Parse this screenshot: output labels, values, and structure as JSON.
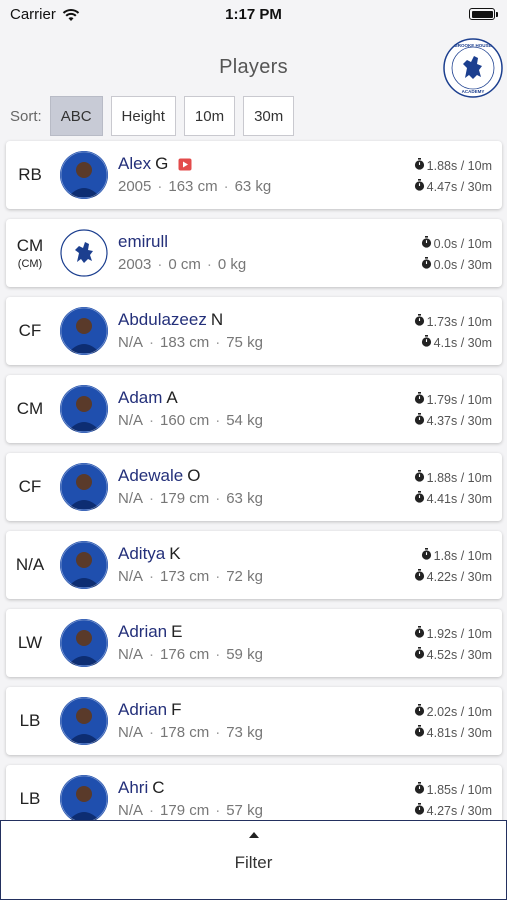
{
  "status_bar": {
    "carrier": "Carrier",
    "time": "1:17 PM"
  },
  "header": {
    "title": "Players",
    "logo_text": "BROOKE HOUSE COLLEGE FOOTBALL ACADEMY"
  },
  "sort": {
    "label": "Sort:",
    "options": [
      "ABC",
      "Height",
      "10m",
      "30m"
    ],
    "active": "ABC"
  },
  "players": [
    {
      "position": "RB",
      "position_sub": "",
      "first_name": "Alex",
      "last_name": "G",
      "year": "2005",
      "height": "163 cm",
      "weight": "63 kg",
      "time_10m": "1.88s / 10m",
      "time_30m": "4.47s / 30m",
      "avatar": "photo",
      "has_video": true
    },
    {
      "position": "CM",
      "position_sub": "(CM)",
      "first_name": "emirull",
      "last_name": "",
      "year": "2003",
      "height": "0 cm",
      "weight": "0 kg",
      "time_10m": "0.0s / 10m",
      "time_30m": "0.0s / 30m",
      "avatar": "crest",
      "has_video": false
    },
    {
      "position": "CF",
      "position_sub": "",
      "first_name": "Abdulazeez",
      "last_name": "N",
      "year": "N/A",
      "height": "183 cm",
      "weight": "75 kg",
      "time_10m": "1.73s / 10m",
      "time_30m": "4.1s / 30m",
      "avatar": "photo",
      "has_video": false
    },
    {
      "position": "CM",
      "position_sub": "",
      "first_name": "Adam",
      "last_name": "A",
      "year": "N/A",
      "height": "160 cm",
      "weight": "54 kg",
      "time_10m": "1.79s / 10m",
      "time_30m": "4.37s / 30m",
      "avatar": "photo",
      "has_video": false
    },
    {
      "position": "CF",
      "position_sub": "",
      "first_name": "Adewale",
      "last_name": "O",
      "year": "N/A",
      "height": "179 cm",
      "weight": "63 kg",
      "time_10m": "1.88s / 10m",
      "time_30m": "4.41s / 30m",
      "avatar": "photo",
      "has_video": false
    },
    {
      "position": "N/A",
      "position_sub": "",
      "first_name": "Aditya",
      "last_name": "K",
      "year": "N/A",
      "height": "173 cm",
      "weight": "72 kg",
      "time_10m": "1.8s / 10m",
      "time_30m": "4.22s / 30m",
      "avatar": "photo",
      "has_video": false
    },
    {
      "position": "LW",
      "position_sub": "",
      "first_name": "Adrian",
      "last_name": "E",
      "year": "N/A",
      "height": "176 cm",
      "weight": "59 kg",
      "time_10m": "1.92s / 10m",
      "time_30m": "4.52s / 30m",
      "avatar": "photo",
      "has_video": false
    },
    {
      "position": "LB",
      "position_sub": "",
      "first_name": "Adrian",
      "last_name": "F",
      "year": "N/A",
      "height": "178 cm",
      "weight": "73 kg",
      "time_10m": "2.02s / 10m",
      "time_30m": "4.81s / 30m",
      "avatar": "photo",
      "has_video": false
    },
    {
      "position": "LB",
      "position_sub": "",
      "first_name": "Ahri",
      "last_name": "C",
      "year": "N/A",
      "height": "179 cm",
      "weight": "57 kg",
      "time_10m": "1.85s / 10m",
      "time_30m": "4.27s / 30m",
      "avatar": "photo",
      "has_video": false
    }
  ],
  "filter": {
    "label": "Filter"
  },
  "colors": {
    "name_first": "#24307a",
    "club_blue": "#1c4aa8",
    "filter_border": "#23305f",
    "active_sort": "#c8cbd6",
    "video_red": "#e34b4b"
  }
}
